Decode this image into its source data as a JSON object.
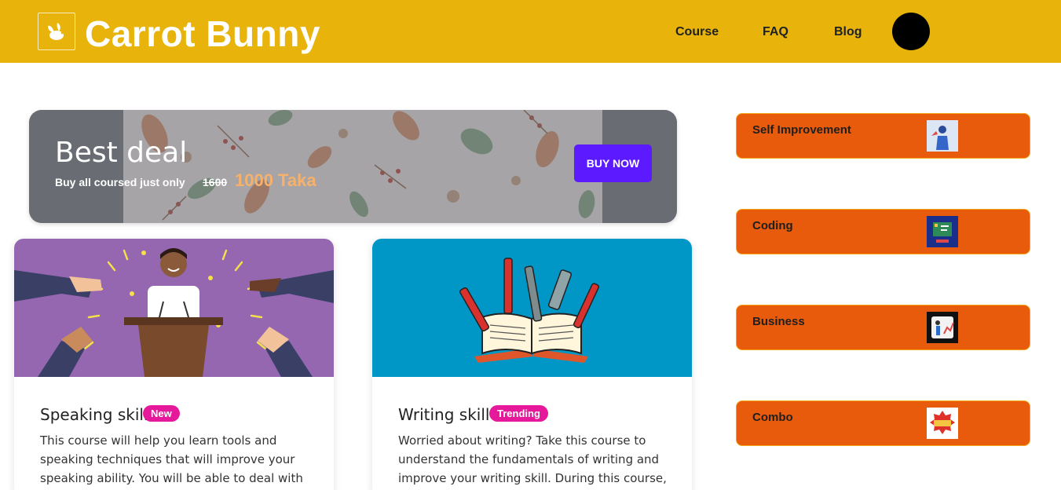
{
  "header": {
    "brand": "Carrot Bunny",
    "logo_icon": "bunny-icon",
    "nav": [
      {
        "label": "Course"
      },
      {
        "label": "FAQ"
      },
      {
        "label": "Blog"
      }
    ],
    "bg_color": "#e8b30a"
  },
  "deal": {
    "title": "Best deal",
    "subtitle": "Buy all coursed just only",
    "old_price": "1600",
    "new_price": "1000 Taka",
    "button_label": "BUY NOW",
    "button_color": "#5b1aff",
    "price_color": "#f6b26b"
  },
  "courses": [
    {
      "title": "Speaking skill",
      "badge": "New",
      "description": "This course will help you learn tools and speaking techniques that will improve your speaking ability. You will be able to deal with",
      "image_icon": "speaker-podium-applause-illustration",
      "image_bg": "#9467b0"
    },
    {
      "title": "Writing skill",
      "badge": "Trending",
      "description": "Worried about writing? Take this course to understand the fundamentals of writing and improve your writing skill. During this course,",
      "image_icon": "open-book-pens-illustration",
      "image_bg": "#0097c7"
    }
  ],
  "badge_color": "#e5199a",
  "categories": [
    {
      "label": "Self Improvement",
      "thumb_icon": "self-improvement-thumbnail"
    },
    {
      "label": "Coding",
      "thumb_icon": "coding-thumbnail"
    },
    {
      "label": "Business",
      "thumb_icon": "business-thumbnail"
    },
    {
      "label": "Combo",
      "thumb_icon": "best-deal-thumbnail"
    }
  ],
  "category_color": "#e85a0c"
}
